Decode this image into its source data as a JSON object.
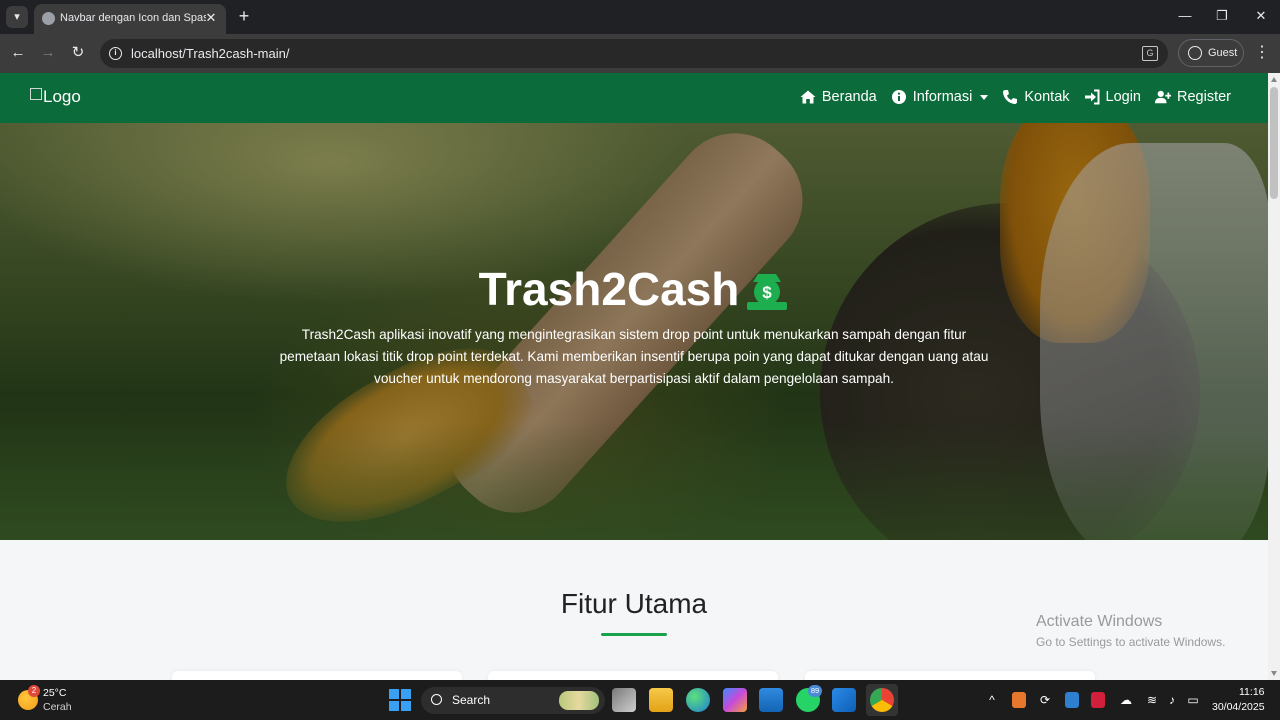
{
  "browser": {
    "tab_title": "Navbar dengan Icon dan Spasi",
    "url": "localhost/Trash2cash-main/",
    "profile_label": "Guest"
  },
  "site": {
    "logo_alt": "Logo",
    "nav": [
      {
        "label": "Beranda",
        "icon": "home-icon"
      },
      {
        "label": "Informasi",
        "icon": "info-circle-icon",
        "dropdown": true
      },
      {
        "label": "Kontak",
        "icon": "phone-icon"
      },
      {
        "label": "Login",
        "icon": "sign-in-icon"
      },
      {
        "label": "Register",
        "icon": "user-plus-icon"
      }
    ],
    "hero": {
      "title": "Trash2Cash",
      "title_icon": "money-bag-icon",
      "text": "Trash2Cash aplikasi inovatif yang mengintegrasikan sistem drop point untuk menukarkan sampah dengan fitur pemetaan lokasi titik drop point terdekat. Kami memberikan insentif berupa poin yang dapat ditukar dengan uang atau voucher untuk mendorong masyarakat berpartisipasi aktif dalam pengelolaan sampah."
    },
    "features_title": "Fitur Utama"
  },
  "watermark": {
    "title": "Activate Windows",
    "subtitle": "Go to Settings to activate Windows."
  },
  "taskbar": {
    "weather_badge": "2",
    "weather_temp": "25°C",
    "weather_condition": "Cerah",
    "search_label": "Search",
    "whatsapp_badge": "89",
    "time": "11:16",
    "date": "30/04/2025"
  },
  "colors": {
    "nav_green": "#0b6b3a",
    "accent_green": "#18a34a"
  }
}
